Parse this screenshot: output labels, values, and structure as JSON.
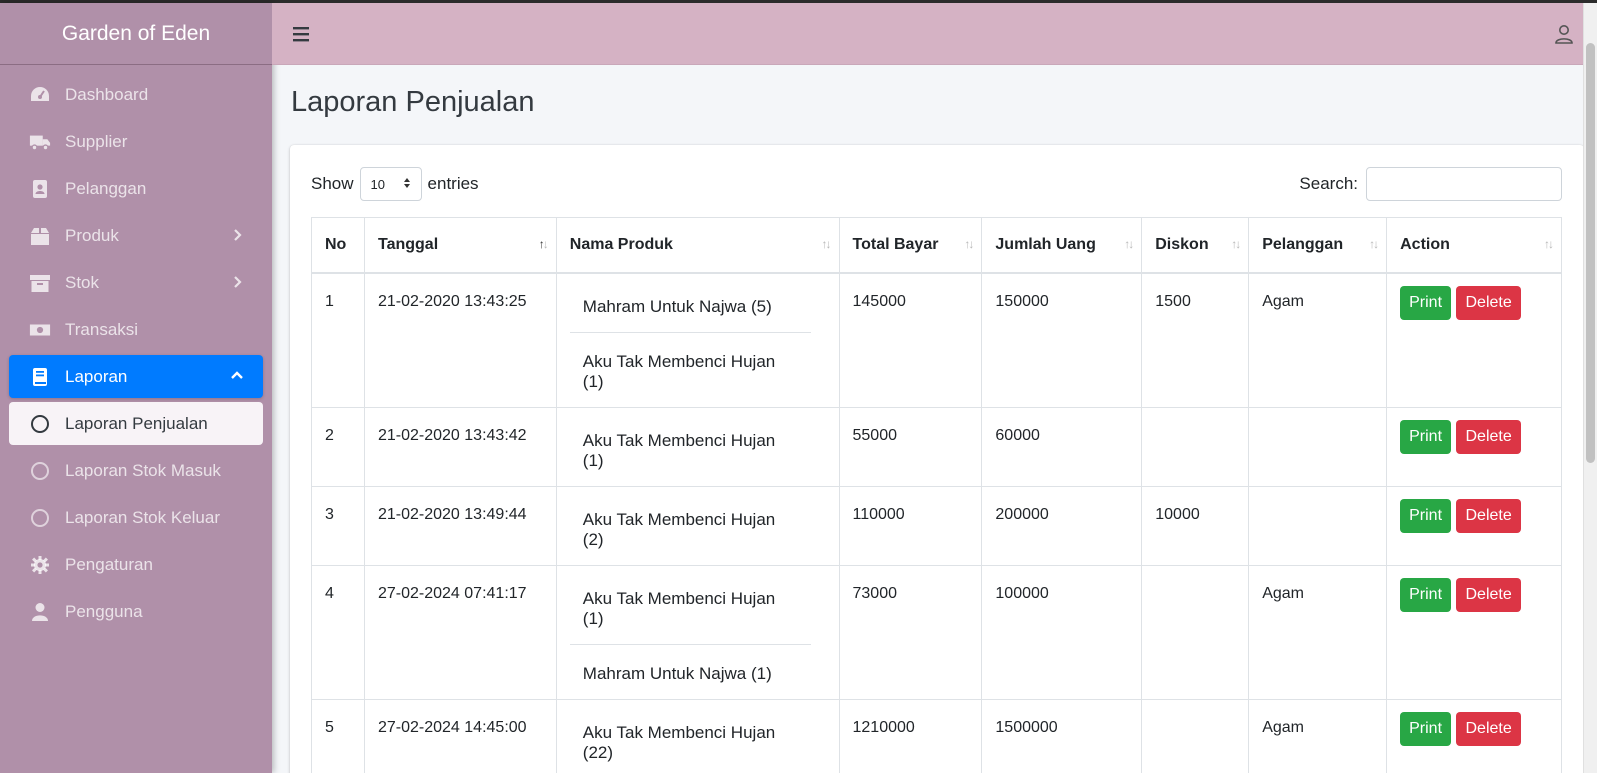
{
  "brand": "Garden of Eden",
  "sidebar": {
    "items": [
      {
        "label": "Dashboard",
        "icon": "gauge-icon"
      },
      {
        "label": "Supplier",
        "icon": "truck-icon"
      },
      {
        "label": "Pelanggan",
        "icon": "contact-book-icon"
      },
      {
        "label": "Produk",
        "icon": "box-icon",
        "has_chevron": true
      },
      {
        "label": "Stok",
        "icon": "archive-icon",
        "has_chevron": true
      },
      {
        "label": "Transaksi",
        "icon": "money-bill-icon"
      },
      {
        "label": "Laporan",
        "icon": "book-icon",
        "active": true
      },
      {
        "label": "Laporan Penjualan",
        "icon": "circle-icon",
        "sub_active": true
      },
      {
        "label": "Laporan Stok Masuk",
        "icon": "circle-icon"
      },
      {
        "label": "Laporan Stok Keluar",
        "icon": "circle-icon"
      },
      {
        "label": "Pengaturan",
        "icon": "gear-icon"
      },
      {
        "label": "Pengguna",
        "icon": "user-icon"
      }
    ]
  },
  "page": {
    "title": "Laporan Penjualan"
  },
  "table_controls": {
    "show_label": "Show",
    "entries_value": "10",
    "entries_label": "entries",
    "search_label": "Search:",
    "search_value": ""
  },
  "table": {
    "columns": [
      "No",
      "Tanggal",
      "Nama Produk",
      "Total Bayar",
      "Jumlah Uang",
      "Diskon",
      "Pelanggan",
      "Action"
    ],
    "sorted_column": "Tanggal",
    "rows": [
      {
        "no": "1",
        "tanggal": "21-02-2020 13:43:25",
        "produk": [
          "Mahram Untuk Najwa (5)",
          "Aku Tak Membenci Hujan (1)"
        ],
        "total": "145000",
        "jumlah": "150000",
        "diskon": "1500",
        "pelanggan": "Agam"
      },
      {
        "no": "2",
        "tanggal": "21-02-2020 13:43:42",
        "produk": [
          "Aku Tak Membenci Hujan (1)"
        ],
        "total": "55000",
        "jumlah": "60000",
        "diskon": "",
        "pelanggan": ""
      },
      {
        "no": "3",
        "tanggal": "21-02-2020 13:49:44",
        "produk": [
          "Aku Tak Membenci Hujan (2)"
        ],
        "total": "110000",
        "jumlah": "200000",
        "diskon": "10000",
        "pelanggan": ""
      },
      {
        "no": "4",
        "tanggal": "27-02-2024 07:41:17",
        "produk": [
          "Aku Tak Membenci Hujan (1)",
          "Mahram Untuk Najwa (1)"
        ],
        "total": "73000",
        "jumlah": "100000",
        "diskon": "",
        "pelanggan": "Agam"
      },
      {
        "no": "5",
        "tanggal": "27-02-2024 14:45:00",
        "produk": [
          "Aku Tak Membenci Hujan (22)"
        ],
        "total": "1210000",
        "jumlah": "1500000",
        "diskon": "",
        "pelanggan": "Agam"
      }
    ],
    "print_label": "Print",
    "delete_label": "Delete"
  },
  "colors": {
    "sidebar_bg": "#b090a9",
    "navbar_bg": "#d5b2c4",
    "active": "#007bff",
    "print": "#28a745",
    "delete": "#dc3545"
  }
}
